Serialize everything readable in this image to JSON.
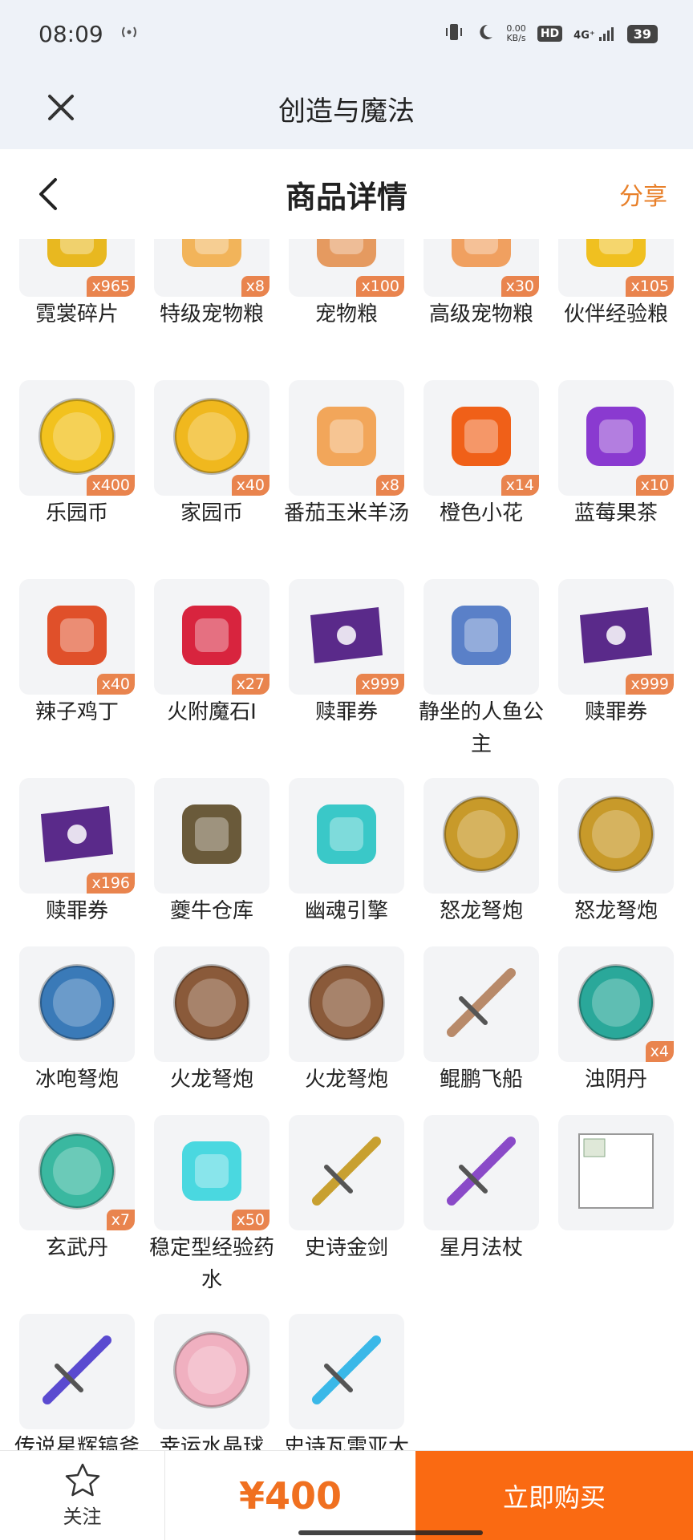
{
  "status": {
    "time": "08:09",
    "speed_value": "0.00",
    "speed_unit": "KB/s",
    "hd": "HD",
    "network": "4G⁺",
    "battery": "39"
  },
  "app": {
    "title": "创造与魔法"
  },
  "page": {
    "title": "商品详情",
    "share": "分享"
  },
  "items": [
    {
      "name": "霓裳碎片",
      "count": "x965",
      "icon": "gold-shard-icon",
      "color": "#e8b820"
    },
    {
      "name": "特级宠物粮",
      "count": "x8",
      "icon": "pet-food-bag-icon",
      "color": "#f2b45a"
    },
    {
      "name": "宠物粮",
      "count": "x100",
      "icon": "pet-food-bag-icon",
      "color": "#e59a60"
    },
    {
      "name": "高级宠物粮",
      "count": "x30",
      "icon": "pet-food-bag-icon",
      "color": "#f0a060"
    },
    {
      "name": "伙伴经验粮",
      "count": "x105",
      "icon": "exp-food-sack-icon",
      "color": "#f0c020"
    },
    {
      "name": "乐园币",
      "count": "x400",
      "icon": "gold-coin-icon",
      "color": "#f2c21e"
    },
    {
      "name": "家园币",
      "count": "x40",
      "icon": "gold-coin-icon",
      "color": "#f0b81e"
    },
    {
      "name": "番茄玉米羊汤",
      "count": "x8",
      "icon": "soup-bowl-icon",
      "color": "#f2a65a"
    },
    {
      "name": "橙色小花",
      "count": "x14",
      "icon": "orange-flower-icon",
      "color": "#f06018"
    },
    {
      "name": "蓝莓果茶",
      "count": "x10",
      "icon": "blueberry-tea-icon",
      "color": "#8a3ad0"
    },
    {
      "name": "辣子鸡丁",
      "count": "x40",
      "icon": "spicy-chicken-dish-icon",
      "color": "#e0502a"
    },
    {
      "name": "火附魔石I",
      "count": "x27",
      "icon": "red-crystal-icon",
      "color": "#d8243e"
    },
    {
      "name": "赎罪券",
      "count": "x999",
      "icon": "purple-scroll-icon",
      "color": "#5a2a8a"
    },
    {
      "name": "静坐的人鱼公主",
      "count": "",
      "icon": "mermaid-statue-icon",
      "color": "#5a80c8"
    },
    {
      "name": "赎罪券",
      "count": "x999",
      "icon": "purple-scroll-icon",
      "color": "#5a2a8a"
    },
    {
      "name": "赎罪券",
      "count": "x196",
      "icon": "purple-scroll-icon",
      "color": "#5a2a8a"
    },
    {
      "name": "夔牛仓库",
      "count": "",
      "icon": "warehouse-icon",
      "color": "#6a5a3a"
    },
    {
      "name": "幽魂引擎",
      "count": "",
      "icon": "ghost-engine-icon",
      "color": "#3ac8c8"
    },
    {
      "name": "怒龙弩炮",
      "count": "",
      "icon": "dragon-ballista-icon",
      "color": "#c89a2a"
    },
    {
      "name": "怒龙弩炮",
      "count": "",
      "icon": "dragon-ballista-icon",
      "color": "#c89a2a"
    },
    {
      "name": "冰咆弩炮",
      "count": "",
      "icon": "ice-ballista-icon",
      "color": "#3a7ab8"
    },
    {
      "name": "火龙弩炮",
      "count": "",
      "icon": "fire-ballista-icon",
      "color": "#8a5a3a"
    },
    {
      "name": "火龙弩炮",
      "count": "",
      "icon": "fire-ballista-icon",
      "color": "#8a5a3a"
    },
    {
      "name": "鲲鹏飞船",
      "count": "",
      "icon": "airship-icon",
      "color": "#b88a6a"
    },
    {
      "name": "浊阴丹",
      "count": "x4",
      "icon": "green-orb-icon",
      "color": "#2aa89a"
    },
    {
      "name": "玄武丹",
      "count": "x7",
      "icon": "turtle-orb-icon",
      "color": "#3ab8a0"
    },
    {
      "name": "稳定型经验药水",
      "count": "x50",
      "icon": "exp-potion-icon",
      "color": "#4ad8e0"
    },
    {
      "name": "史诗金剑",
      "count": "",
      "icon": "golden-blade-icon",
      "color": "#c8a030"
    },
    {
      "name": "星月法杖",
      "count": "",
      "icon": "star-moon-staff-icon",
      "color": "#8a4ac8"
    },
    {
      "name": "",
      "count": "",
      "icon": "broken-image-icon",
      "color": "#cccccc"
    },
    {
      "name": "传说星辉镐斧",
      "count": "",
      "icon": "axe-icon",
      "color": "#5a4ad0"
    },
    {
      "name": "幸运水晶球",
      "count": "",
      "icon": "crystal-ball-icon",
      "color": "#f0b0c0"
    },
    {
      "name": "史诗瓦雷亚大剑",
      "count": "",
      "icon": "great-sword-icon",
      "color": "#3ab8e8"
    }
  ],
  "footer": {
    "follow": "关注",
    "price": "¥400",
    "buy": "立即购买"
  },
  "colors": {
    "accent": "#fa6a12",
    "share": "#e8802a",
    "badge": "#e8783c"
  }
}
